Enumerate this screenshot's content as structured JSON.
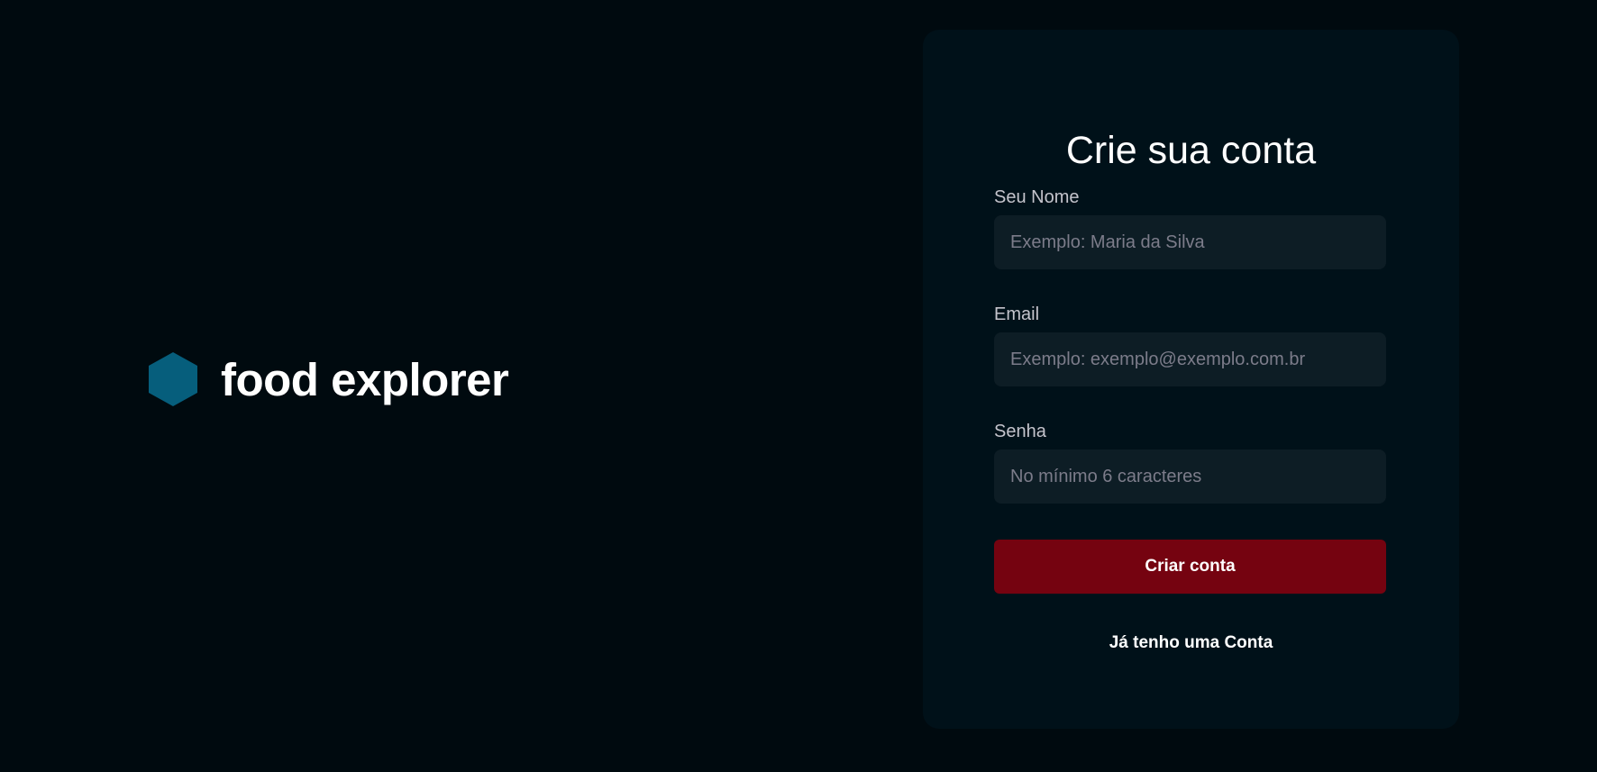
{
  "brand": {
    "logo_icon": "hexagon-icon",
    "logo_color": "#065E7C",
    "name": "food explorer"
  },
  "signup_form": {
    "title": "Crie sua conta",
    "fields": [
      {
        "label": "Seu Nome",
        "placeholder": "Exemplo: Maria da Silva",
        "value": ""
      },
      {
        "label": "Email",
        "placeholder": "Exemplo: exemplo@exemplo.com.br",
        "value": ""
      },
      {
        "label": "Senha",
        "placeholder": "No mínimo 6 caracteres",
        "value": ""
      }
    ],
    "submit_label": "Criar conta",
    "submit_color": "#750310",
    "login_link_label": "Já tenho uma Conta"
  }
}
